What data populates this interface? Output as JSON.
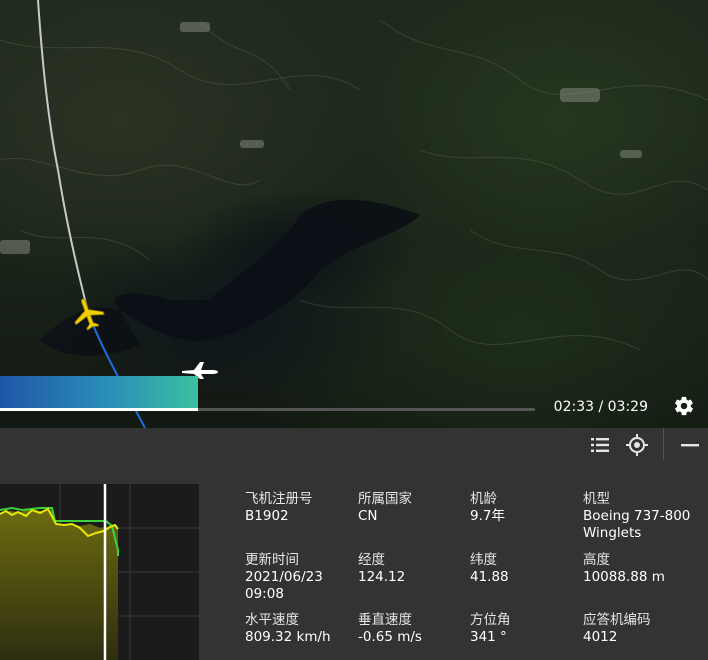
{
  "playback": {
    "progress": 0.37,
    "current_time": "02:33",
    "total_time": "03:29",
    "time_separator": " / "
  },
  "toolbar": {
    "list_icon": "list-icon",
    "locate_icon": "crosshair-icon",
    "minimize_icon": "minimize-icon"
  },
  "aircraft_info": {
    "registration": {
      "label": "飞机注册号",
      "value": "B1902"
    },
    "country": {
      "label": "所属国家",
      "value": "CN"
    },
    "age": {
      "label": "机龄",
      "value": "9.7年"
    },
    "model": {
      "label": "机型",
      "value": "Boeing 737-800 Winglets"
    },
    "updated": {
      "label": "更新时间",
      "value": "2021/06/23 09:08"
    },
    "longitude": {
      "label": "经度",
      "value": "124.12"
    },
    "latitude": {
      "label": "纬度",
      "value": "41.88"
    },
    "altitude": {
      "label": "高度",
      "value": "10088.88 m"
    },
    "ground_speed": {
      "label": "水平速度",
      "value": "809.32 km/h"
    },
    "vertical_speed": {
      "label": "垂直速度",
      "value": "-0.65 m/s"
    },
    "heading": {
      "label": "方位角",
      "value": "341 °"
    },
    "squawk": {
      "label": "应答机编码",
      "value": "4012"
    }
  },
  "colors": {
    "flight_path_past": "#c8c8c8",
    "flight_path_future": "#1e6fd9",
    "aircraft_active": "#f0d000",
    "chart_fill": "#6b6b10",
    "chart_altitude_line": "#e8e800",
    "chart_speed_line": "#3cd23c"
  }
}
